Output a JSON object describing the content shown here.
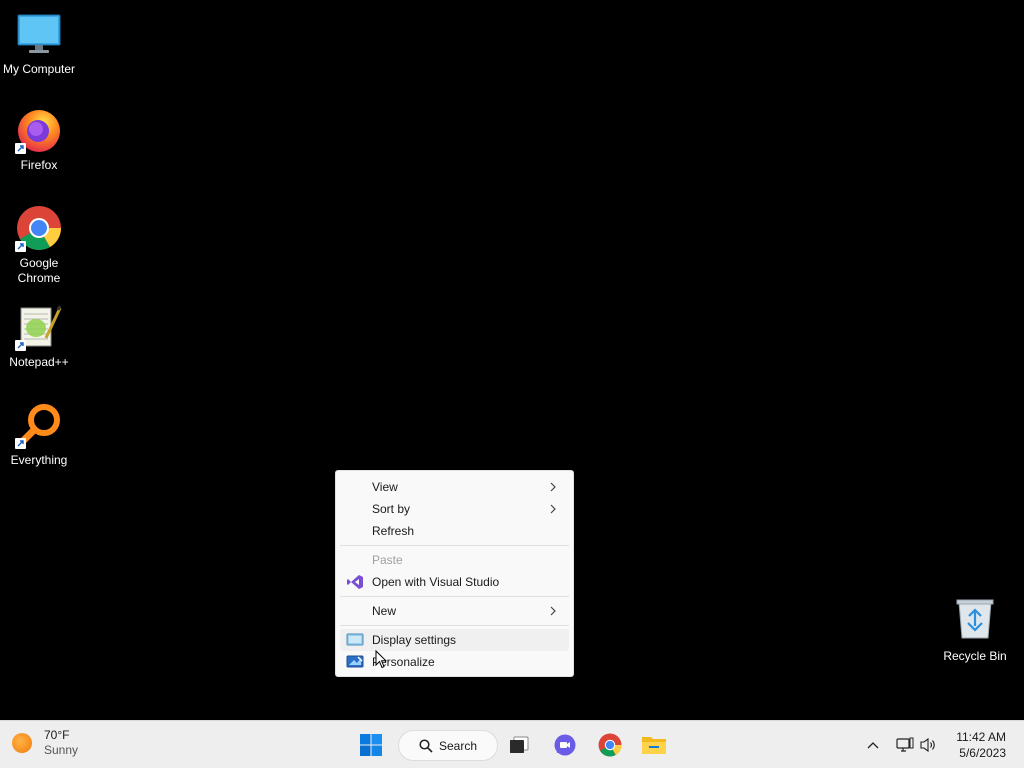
{
  "desktop": {
    "icons": [
      {
        "label": "My Computer",
        "icon": "monitor-icon"
      },
      {
        "label": "Firefox",
        "icon": "firefox-icon"
      },
      {
        "label": "Google Chrome",
        "icon": "chrome-icon"
      },
      {
        "label": "Notepad++",
        "icon": "notepadpp-icon"
      },
      {
        "label": "Everything",
        "icon": "everything-icon"
      }
    ],
    "recycle_bin": {
      "label": "Recycle Bin",
      "icon": "recycle-bin-icon"
    }
  },
  "context_menu": {
    "view": "View",
    "sort_by": "Sort by",
    "refresh": "Refresh",
    "paste": "Paste",
    "open_vs": "Open with Visual Studio",
    "new": "New",
    "display_settings": "Display settings",
    "personalize": "Personalize"
  },
  "taskbar": {
    "weather_temp": "70°F",
    "weather_cond": "Sunny",
    "search_label": "Search",
    "time": "11:42 AM",
    "date": "5/6/2023"
  },
  "colors": {
    "desktop_bg": "#000000",
    "taskbar_bg": "#eeeeee",
    "menu_bg": "#f9f9f9",
    "accent": "#0078d4"
  }
}
